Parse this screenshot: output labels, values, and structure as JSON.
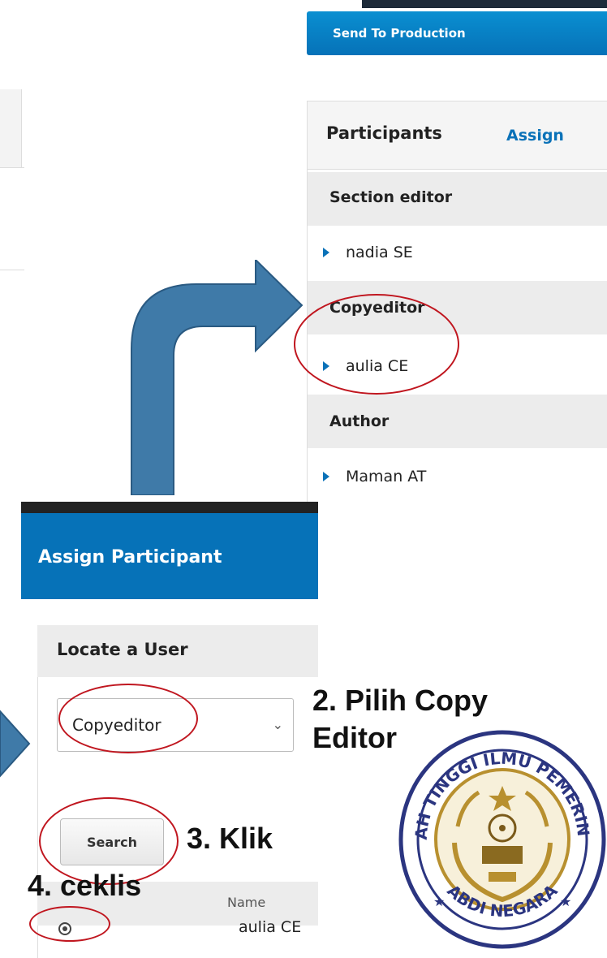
{
  "top_button": {
    "label": "Send To Production"
  },
  "participants": {
    "title": "Participants",
    "assign_link": "Assign",
    "groups": [
      {
        "label": "Section editor",
        "members": [
          "nadia SE"
        ]
      },
      {
        "label": "Copyeditor",
        "members": [
          "aulia CE"
        ]
      },
      {
        "label": "Author",
        "members": [
          "Maman AT"
        ]
      }
    ]
  },
  "modal": {
    "title": "Assign Participant",
    "locate_title": "Locate a User",
    "role_select": {
      "selected": "Copyeditor"
    },
    "search_button": "Search",
    "table": {
      "columns": [
        "Name"
      ],
      "rows": [
        {
          "name": "aulia CE"
        }
      ]
    }
  },
  "annotations": {
    "step2_line1": "2. Pilih Copy",
    "step2_line2": "Editor",
    "step3": "3. Klik",
    "step4": "4. ceklis"
  },
  "seal": {
    "top_text": "SEKOLAH TINGGI ILMU PEMERINTAHAN",
    "bottom_text": "ABDI NEGARA"
  },
  "colors": {
    "primary_blue": "#0672b8",
    "arrow_blue": "#3f7aa8",
    "annotation_red": "#c0161f",
    "seal_gold": "#b8902f",
    "seal_navy": "#2b3580"
  }
}
